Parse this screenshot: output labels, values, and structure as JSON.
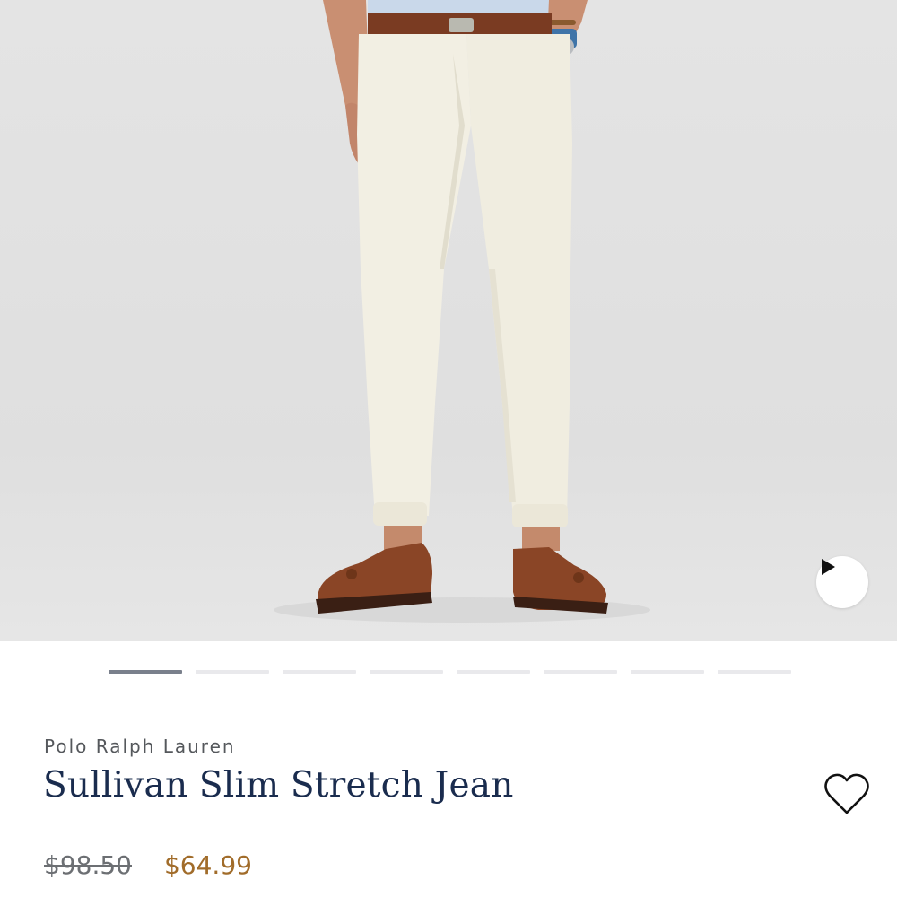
{
  "product": {
    "brand": "Polo Ralph Lauren",
    "name": "Sullivan Slim Stretch Jean",
    "original_price": "$98.50",
    "sale_price": "$64.99"
  },
  "gallery": {
    "image_count": 8,
    "active_index": 0
  },
  "icons": {
    "play": "play-icon",
    "wishlist": "heart-icon"
  },
  "colors": {
    "title": "#1a2c4e",
    "sale_price": "#a16c2a",
    "active_dot": "#7a808c",
    "inactive_dot": "#e9e9ec"
  }
}
